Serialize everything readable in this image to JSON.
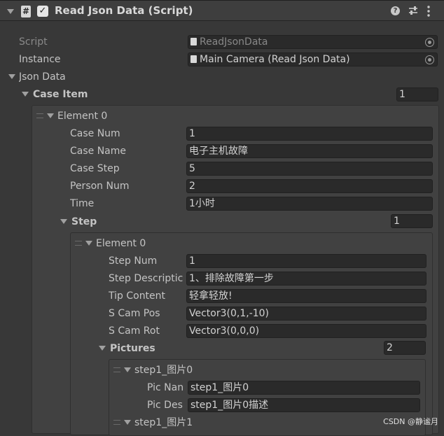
{
  "header": {
    "title": "Read Json Data (Script)",
    "script_icon_glyph": "#",
    "enabled_checkmark": "✓"
  },
  "script_field": {
    "label": "Script",
    "value": "ReadJsonData"
  },
  "instance_field": {
    "label": "Instance",
    "value": "Main Camera (Read Json Data)"
  },
  "json_data": {
    "label": "Json Data"
  },
  "case_item": {
    "label": "Case Item",
    "size": "1",
    "element_label": "Element 0",
    "fields": [
      {
        "label": "Case Num",
        "value": "1"
      },
      {
        "label": "Case Name",
        "value": "电子主机故障"
      },
      {
        "label": "Case Step",
        "value": "5"
      },
      {
        "label": "Person Num",
        "value": "2"
      },
      {
        "label": "Time",
        "value": "1小时"
      }
    ],
    "step": {
      "label": "Step",
      "size": "1",
      "element_label": "Element 0",
      "fields": [
        {
          "label": "Step Num",
          "value": "1"
        },
        {
          "label": "Step Descriptic",
          "value": "1、排除故障第一步"
        },
        {
          "label": "Tip Content",
          "value": "轻拿轻放!"
        },
        {
          "label": "S Cam Pos",
          "value": "Vector3(0,1,-10)"
        },
        {
          "label": "S Cam Rot",
          "value": "Vector3(0,0,0)"
        }
      ],
      "pictures": {
        "label": "Pictures",
        "size": "2",
        "items": [
          {
            "label": "step1_图片0",
            "fields": [
              {
                "label": "Pic Nan",
                "value": "step1_图片0"
              },
              {
                "label": "Pic Des",
                "value": "step1_图片0描述"
              }
            ]
          },
          {
            "label": "step1_图片1"
          }
        ]
      }
    }
  },
  "watermark": "CSDN @静谧月"
}
